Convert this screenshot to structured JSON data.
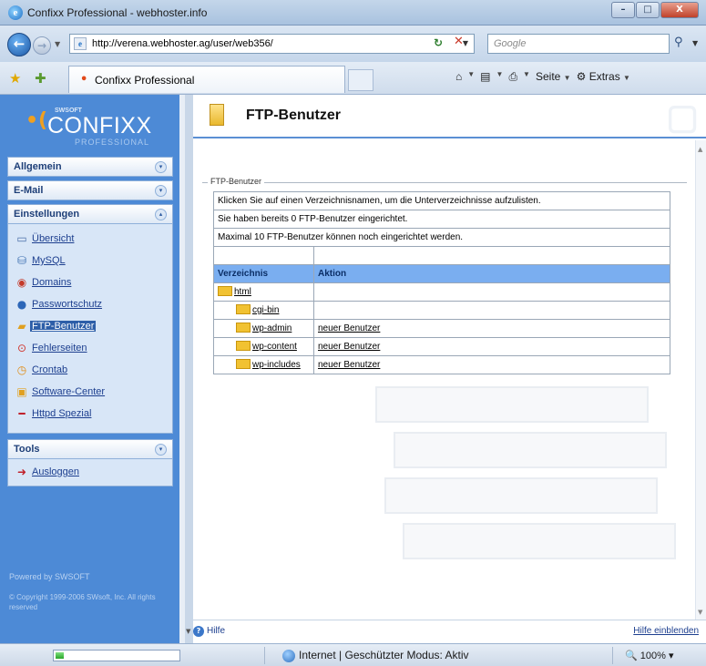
{
  "window": {
    "title": "Confixx Professional - webhoster.info",
    "controls": [
      "–",
      "□",
      "X"
    ]
  },
  "addressbar": {
    "url": "http://verena.webhoster.ag/user/web356/",
    "search_placeholder": "Google",
    "back_icon": "back-arrow-icon",
    "forward_icon": "forward-arrow-icon"
  },
  "tabbar": {
    "tab_label": "Confixx Professional",
    "tools": {
      "page": "Seite",
      "extras": "Extras"
    }
  },
  "sidebar": {
    "logo_brand": "SWSOFT",
    "logo_name": "CONFIXX",
    "logo_sub": "PROFESSIONAL",
    "panels": {
      "allgemein": "Allgemein",
      "email": "E-Mail",
      "einstellungen": "Einstellungen",
      "tools": "Tools"
    },
    "items": [
      {
        "label": "Übersicht",
        "icon": "page-icon",
        "color": "#4a6fa8"
      },
      {
        "label": "MySQL",
        "icon": "database-icon",
        "color": "#3c6fb0"
      },
      {
        "label": "Domains",
        "icon": "globe-icon",
        "color": "#c43a2a"
      },
      {
        "label": "Passwortschutz",
        "icon": "lock-icon",
        "color": "#2c66b8"
      },
      {
        "label": "FTP-Benutzer",
        "icon": "ftp-folder-icon",
        "color": "#e0a020"
      },
      {
        "label": "Fehlerseiten",
        "icon": "error-page-icon",
        "color": "#d0342c"
      },
      {
        "label": "Crontab",
        "icon": "clock-icon",
        "color": "#e08a10"
      },
      {
        "label": "Software-Center",
        "icon": "box-icon",
        "color": "#e0a020"
      },
      {
        "label": "Httpd Spezial",
        "icon": "dash-icon",
        "color": "#c0202a"
      }
    ],
    "tools_items": [
      {
        "label": "Ausloggen",
        "icon": "logout-icon",
        "color": "#c0202a"
      }
    ],
    "footer_powered": "Powered by SWSOFT",
    "footer_copyright": "© Copyright 1999-2006 SWsoft, Inc. All rights reserved"
  },
  "content": {
    "title": "FTP-Benutzer",
    "fieldset_legend": "FTP-Benutzer",
    "info_lines": [
      "Klicken Sie auf einen Verzeichnisnamen, um die Unterverzeichnisse aufzulisten.",
      "Sie haben bereits 0 FTP-Benutzer eingerichtet.",
      "Maximal 10 FTP-Benutzer können noch eingerichtet werden."
    ],
    "table_headers": {
      "directory": "Verzeichnis",
      "action": "Aktion"
    },
    "rows": [
      {
        "dir": "html",
        "action": "",
        "indent": 0
      },
      {
        "dir": "cgi-bin",
        "action": "",
        "indent": 1
      },
      {
        "dir": "wp-admin",
        "action": "neuer Benutzer",
        "indent": 1
      },
      {
        "dir": "wp-content",
        "action": "neuer Benutzer",
        "indent": 1
      },
      {
        "dir": "wp-includes",
        "action": "neuer Benutzer",
        "indent": 1
      }
    ],
    "help_label": "Hilfe",
    "show_help_label": "Hilfe einblenden"
  },
  "statusbar": {
    "zone_text": "Internet | Geschützter Modus: Aktiv",
    "zoom": "100%",
    "progress": 0.07
  }
}
